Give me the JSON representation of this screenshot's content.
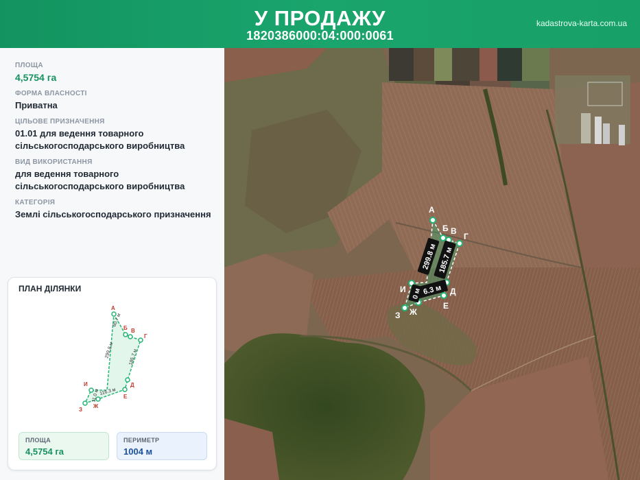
{
  "header": {
    "title": "У ПРОДАЖУ",
    "cadastral_number": "1820386000:04:000:0061",
    "site": "kadastrova-karta.com.ua"
  },
  "info": {
    "area_label": "ПЛОЩА",
    "area_value": "4,5754 га",
    "ownership_label": "ФОРМА ВЛАСНОСТІ",
    "ownership_value": "Приватна",
    "purpose_label": "ЦІЛЬОВЕ ПРИЗНАЧЕННЯ",
    "purpose_line1": "01.01 для ведення товарного",
    "purpose_line2": "сільськогосподарського виробництва",
    "usage_label": "ВИД ВИКОРИСТАННЯ",
    "usage_line1": "для ведення товарного",
    "usage_line2": "сільськогосподарського виробництва",
    "category_label": "КАТЕГОРІЯ",
    "category_value": "Землі сільськогосподарського призначення"
  },
  "plan": {
    "title": "ПЛАН ДІЛЯНКИ",
    "vertices": [
      "А",
      "Б",
      "В",
      "Г",
      "Д",
      "Е",
      "Ж",
      "З",
      "И"
    ],
    "sides": {
      "top": "60.7 м",
      "left": "299.8 м",
      "right": "185.7 м",
      "bottom": "116.3 м",
      "small": "11.0 м"
    },
    "area_label": "ПЛОЩА",
    "area_value": "4,5754 га",
    "perimeter_label": "ПЕРИМЕТР",
    "perimeter_value": "1004 м"
  },
  "map": {
    "vertices": [
      "А",
      "Б",
      "В",
      "Г",
      "Д",
      "Е",
      "Ж",
      "З",
      "И"
    ],
    "side_left": "299.8 м",
    "side_right": "185.7 м",
    "side_bottom": "6.3 м",
    "side_small": "0 м"
  },
  "colors": {
    "header_green": "#17a068",
    "parcel_fill": "#23b573",
    "vertex_label_plan": "#c0392b"
  }
}
